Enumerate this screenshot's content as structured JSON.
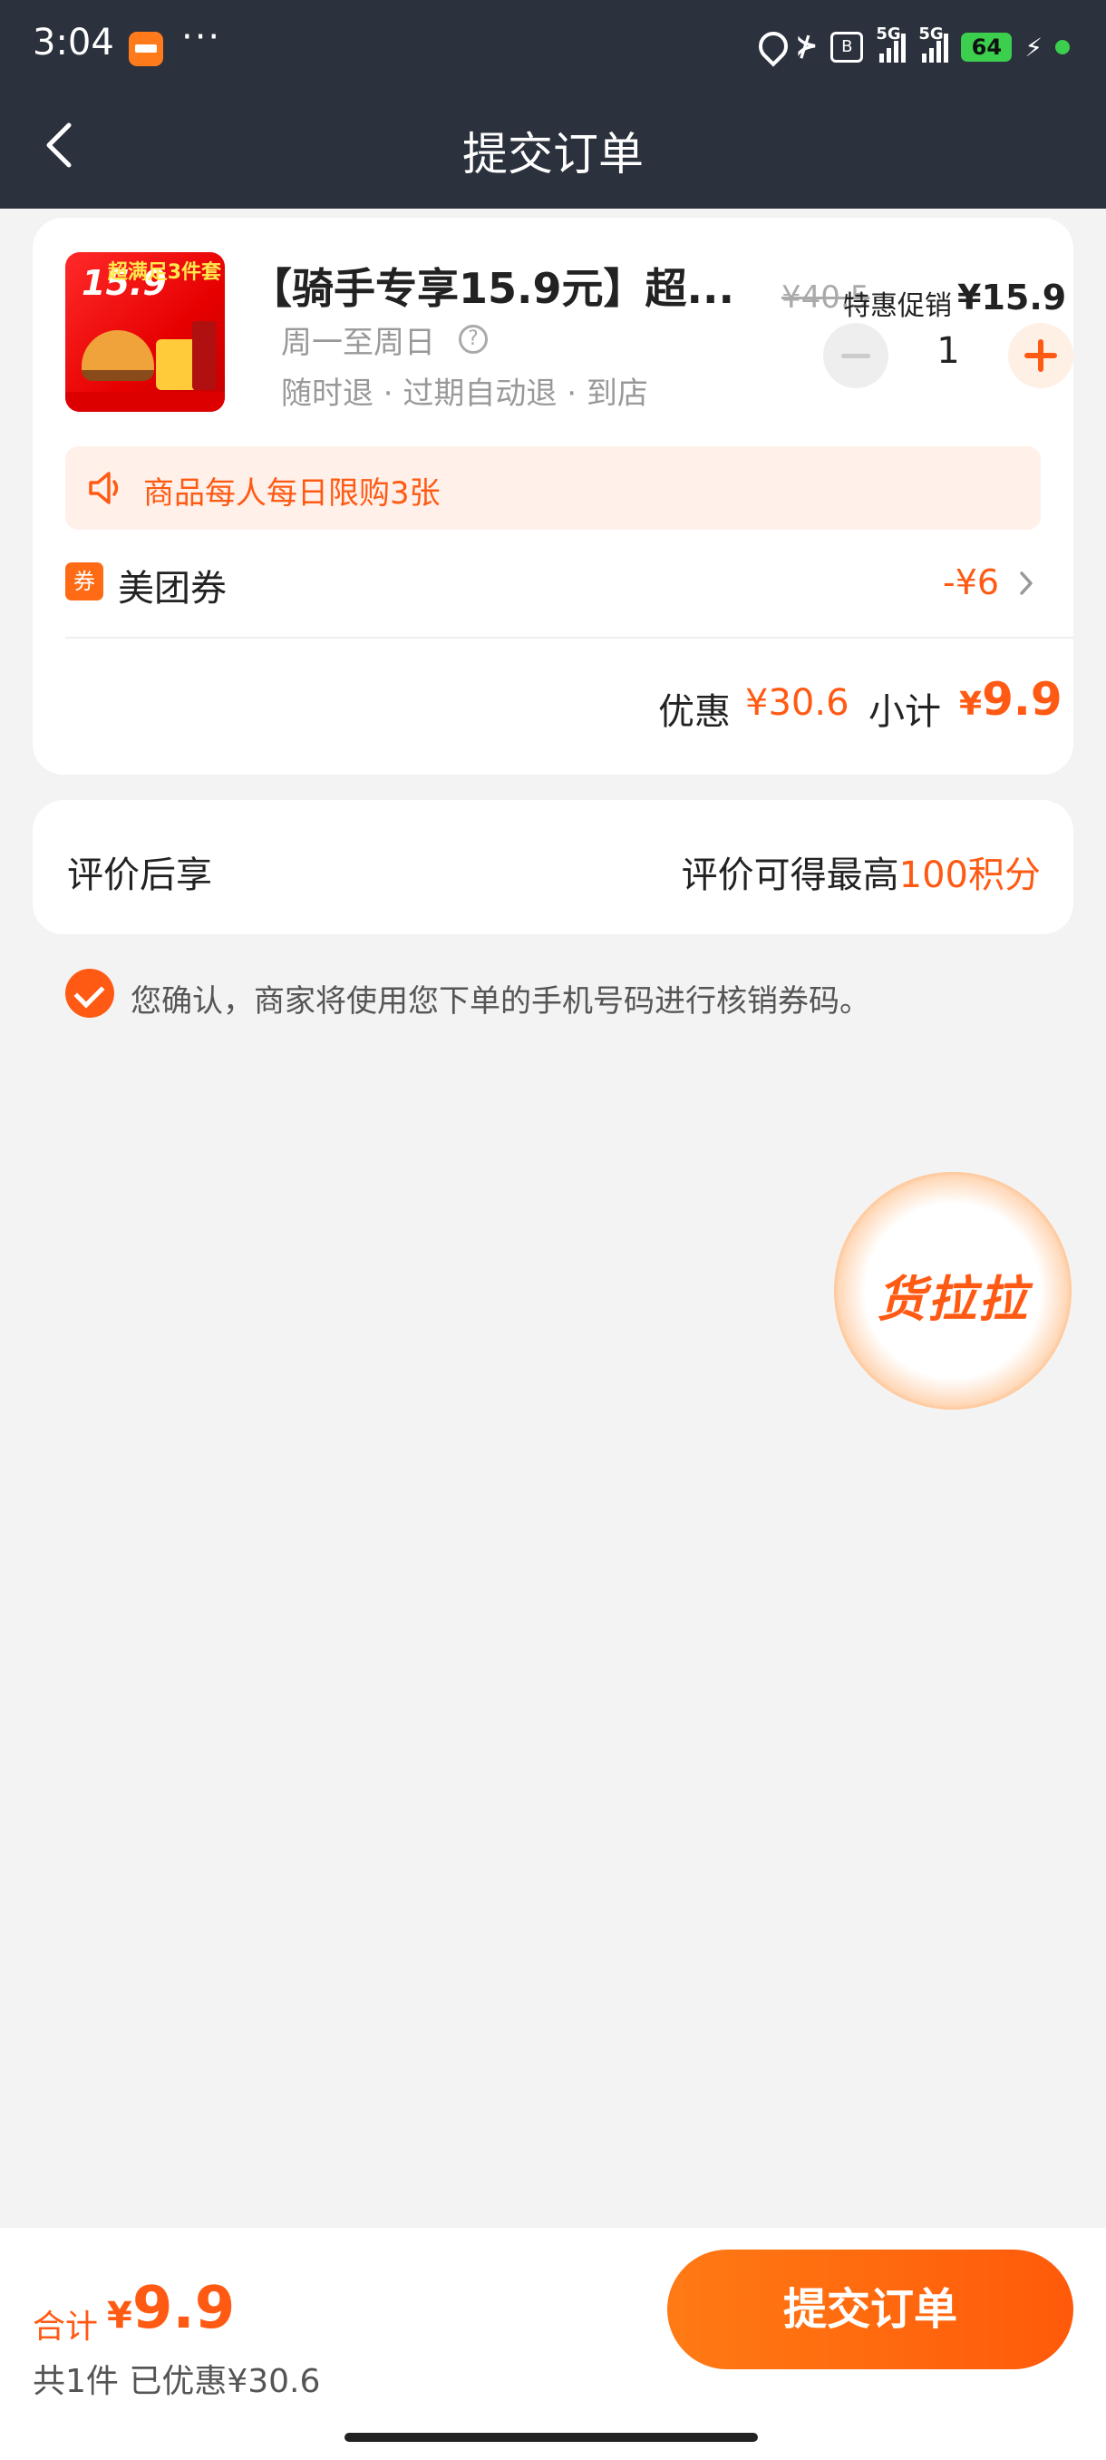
{
  "status_bar": {
    "time": "3:04",
    "more": "···",
    "bluetooth": "⊁",
    "sim_badge": "B",
    "signal1_label": "5G",
    "signal2_label": "5G",
    "battery": "64",
    "charging": "⚡"
  },
  "nav": {
    "title": "提交订单"
  },
  "product": {
    "thumb_price": "15.9",
    "thumb_tag": "超满足3件套",
    "title": "【骑手专享15.9元】超...",
    "days": "周一至周日",
    "help": "?",
    "tags": "随时退 · 过期自动退 · 到店",
    "original_price": "¥40.5",
    "promo_label": "特惠促销",
    "promo_price": "¥15.9",
    "quantity": "1"
  },
  "limit_notice": "商品每人每日限购3张",
  "coupon": {
    "badge": "券",
    "label": "美团券",
    "amount": "-¥6"
  },
  "summary": {
    "discount_label": "优惠",
    "discount_value": "¥30.6",
    "subtotal_label": "小计",
    "subtotal_currency": "¥",
    "subtotal_value": "9.9"
  },
  "review": {
    "label": "评价后享",
    "value_prefix": "评价可得最高",
    "value_highlight": "100积分"
  },
  "confirm_text": "您确认，商家将使用您下单的手机号码进行核销券码。",
  "float_badge": "货拉拉",
  "bottom": {
    "total_label": "合计",
    "total_currency": "¥",
    "total_value": "9.9",
    "info": "共1件  已优惠¥30.6",
    "submit_label": "提交订单"
  },
  "colors": {
    "accent": "#ff5a14",
    "nav_bg": "#2b313d",
    "page_bg": "#f3f3f3"
  },
  "icons": {
    "back": "chevron-left-icon",
    "speaker": "speaker-icon",
    "chevron": "chevron-right-icon",
    "check": "check-icon"
  }
}
